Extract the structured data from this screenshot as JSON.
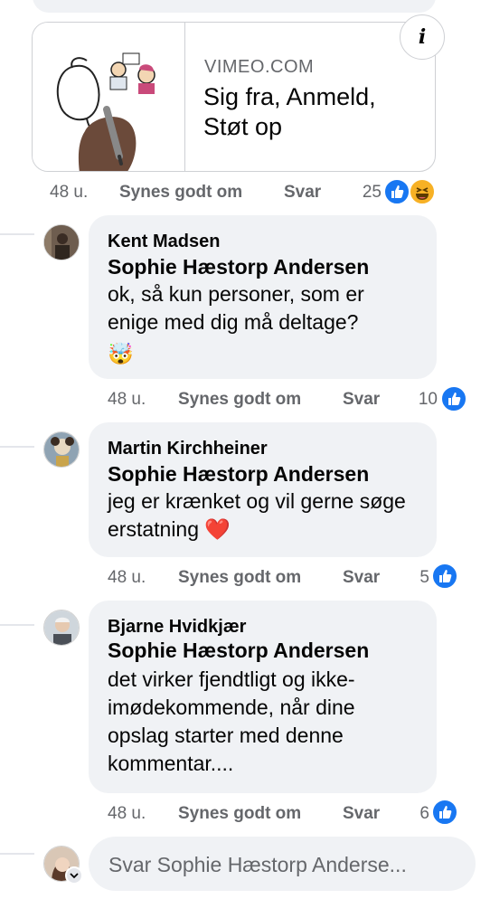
{
  "link_preview": {
    "domain": "VIMEO.COM",
    "title": "Sig fra, Anmeld, Støt op",
    "info_icon": "info-icon",
    "meta": {
      "time": "48 u.",
      "like_label": "Synes godt om",
      "reply_label": "Svar",
      "reaction_count": "25"
    }
  },
  "comments": [
    {
      "author": "Kent Madsen",
      "mention": "Sophie Hæstorp Andersen",
      "text": "ok, så kun personer, som er enige med dig må deltage?",
      "emoji": "🤯",
      "meta": {
        "time": "48 u.",
        "like_label": "Synes godt om",
        "reply_label": "Svar",
        "reaction_count": "10"
      }
    },
    {
      "author": "Martin Kirchheiner",
      "mention": "Sophie Hæstorp Andersen",
      "text": "jeg er krænket og vil gerne søge erstatning ❤️",
      "meta": {
        "time": "48 u.",
        "like_label": "Synes godt om",
        "reply_label": "Svar",
        "reaction_count": "5"
      }
    },
    {
      "author": "Bjarne Hvidkjær",
      "mention": "Sophie Hæstorp Andersen",
      "text": "det virker fjendtligt og ikke-imødekommende, når dine opslag starter med denne kommentar....",
      "meta": {
        "time": "48 u.",
        "like_label": "Synes godt om",
        "reply_label": "Svar",
        "reaction_count": "6"
      }
    }
  ],
  "reply": {
    "placeholder": "Svar Sophie Hæstorp Anderse..."
  },
  "colors": {
    "bubble": "#f0f2f5",
    "like_blue": "#1877f2",
    "meta_gray": "#65676b"
  }
}
